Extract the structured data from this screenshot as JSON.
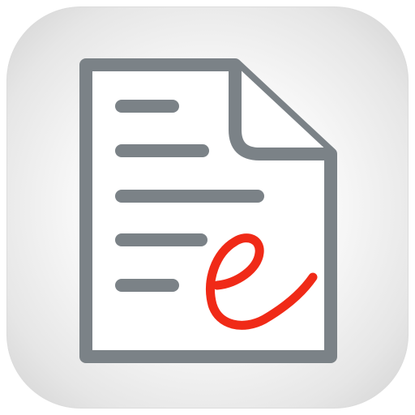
{
  "icon": {
    "name": "e-document-app-icon",
    "glyph": "e",
    "colors": {
      "tile_center": "#ffffff",
      "tile_edge": "#d2d2d2",
      "document_outline": "#7b8287",
      "document_fill": "#ffffff",
      "text_lines": "#7b8287",
      "e_mark": "#f02a17"
    },
    "text_line_count": 5
  }
}
